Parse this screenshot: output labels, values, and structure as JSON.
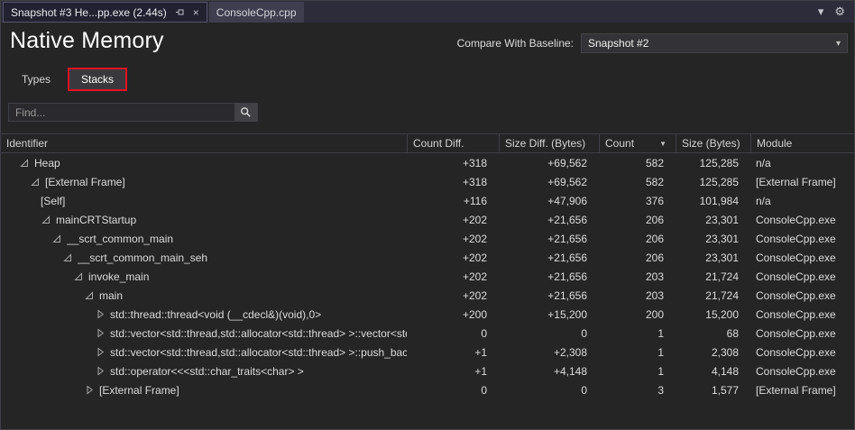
{
  "window": {
    "tabs": [
      {
        "label": "Snapshot #3 He...pp.exe (2.44s)",
        "active": true
      },
      {
        "label": "ConsoleCpp.cpp",
        "active": false
      }
    ]
  },
  "icons": {
    "close": "×",
    "chevron_down": "▾",
    "gear": "⚙",
    "combo_arrow": "▾",
    "sort_desc": "▼"
  },
  "header": {
    "title": "Native Memory",
    "baseline_label": "Compare With Baseline:",
    "baseline_value": "Snapshot #2"
  },
  "view_tabs": {
    "types": "Types",
    "stacks": "Stacks"
  },
  "search": {
    "placeholder": "Find..."
  },
  "colors": {
    "highlight_red": "#e81123",
    "background": "#252526",
    "tabstrip": "#2c2c3a"
  },
  "table": {
    "columns": [
      "Identifier",
      "Count Diff.",
      "Size Diff. (Bytes)",
      "Count",
      "Size (Bytes)",
      "Module"
    ],
    "sort_column": "Count",
    "sort_direction": "descending",
    "rows": [
      {
        "level": 0,
        "state": "expanded",
        "identifier": "Heap",
        "count_diff": "+318",
        "size_diff": "+69,562",
        "count": "582",
        "size": "125,285",
        "module": "n/a"
      },
      {
        "level": 1,
        "state": "expanded",
        "identifier": "[External Frame]",
        "count_diff": "+318",
        "size_diff": "+69,562",
        "count": "582",
        "size": "125,285",
        "module": "[External Frame]"
      },
      {
        "level": 2,
        "state": "leaf",
        "identifier": "[Self]",
        "count_diff": "+116",
        "size_diff": "+47,906",
        "count": "376",
        "size": "101,984",
        "module": "n/a"
      },
      {
        "level": 2,
        "state": "expanded",
        "identifier": "mainCRTStartup",
        "count_diff": "+202",
        "size_diff": "+21,656",
        "count": "206",
        "size": "23,301",
        "module": "ConsoleCpp.exe"
      },
      {
        "level": 3,
        "state": "expanded",
        "identifier": "__scrt_common_main",
        "count_diff": "+202",
        "size_diff": "+21,656",
        "count": "206",
        "size": "23,301",
        "module": "ConsoleCpp.exe"
      },
      {
        "level": 4,
        "state": "expanded",
        "identifier": "__scrt_common_main_seh",
        "count_diff": "+202",
        "size_diff": "+21,656",
        "count": "206",
        "size": "23,301",
        "module": "ConsoleCpp.exe"
      },
      {
        "level": 5,
        "state": "expanded",
        "identifier": "invoke_main",
        "count_diff": "+202",
        "size_diff": "+21,656",
        "count": "203",
        "size": "21,724",
        "module": "ConsoleCpp.exe"
      },
      {
        "level": 6,
        "state": "expanded",
        "identifier": "main",
        "count_diff": "+202",
        "size_diff": "+21,656",
        "count": "203",
        "size": "21,724",
        "module": "ConsoleCpp.exe"
      },
      {
        "level": 7,
        "state": "collapsed",
        "identifier": "std::thread::thread<void (__cdecl&)(void),0>",
        "count_diff": "+200",
        "size_diff": "+15,200",
        "count": "200",
        "size": "15,200",
        "module": "ConsoleCpp.exe"
      },
      {
        "level": 7,
        "state": "collapsed",
        "identifier": "std::vector<std::thread,std::allocator<std::thread> >::vector<std",
        "count_diff": "0",
        "size_diff": "0",
        "count": "1",
        "size": "68",
        "module": "ConsoleCpp.exe"
      },
      {
        "level": 7,
        "state": "collapsed",
        "identifier": "std::vector<std::thread,std::allocator<std::thread> >::push_back",
        "count_diff": "+1",
        "size_diff": "+2,308",
        "count": "1",
        "size": "2,308",
        "module": "ConsoleCpp.exe"
      },
      {
        "level": 7,
        "state": "collapsed",
        "identifier": "std::operator<<<std::char_traits<char> >",
        "count_diff": "+1",
        "size_diff": "+4,148",
        "count": "1",
        "size": "4,148",
        "module": "ConsoleCpp.exe"
      },
      {
        "level": 6,
        "state": "collapsed",
        "identifier": "[External Frame]",
        "count_diff": "0",
        "size_diff": "0",
        "count": "3",
        "size": "1,577",
        "module": "[External Frame]"
      }
    ]
  }
}
